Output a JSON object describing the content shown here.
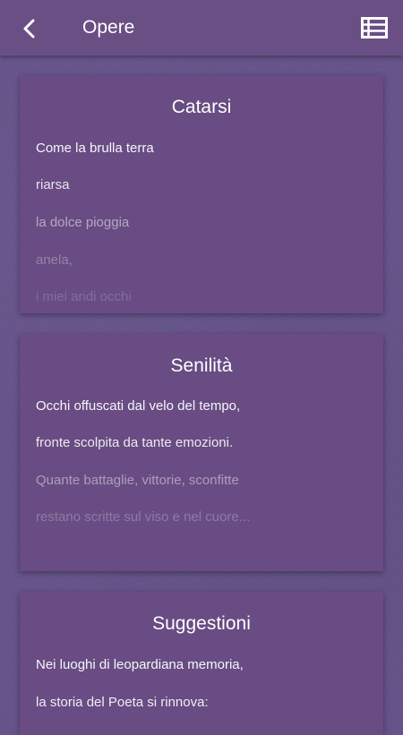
{
  "header": {
    "title": "Opere",
    "back_icon": "back-chevron-icon",
    "menu_icon": "list-view-icon"
  },
  "cards": [
    {
      "title": "Catarsi",
      "lines": [
        "Come la brulla terra",
        "riarsa",
        "la dolce pioggia",
        "anela,",
        "i miei aridi occhi"
      ]
    },
    {
      "title": "Senilità",
      "lines": [
        "Occhi offuscati dal velo del tempo,",
        "fronte scolpita da tante emozioni.",
        "Quante battaglie, vittorie, sconfitte",
        "restano scritte sul viso e nel cuore..."
      ]
    },
    {
      "title": "Suggestioni",
      "lines": [
        "Nei luoghi di leopardiana memoria,",
        "la storia del Poeta si rinnova:"
      ]
    }
  ],
  "colors": {
    "background": "#66538a",
    "appbar": "#6a4f85",
    "card": "#684c83",
    "text": "#ffffff"
  }
}
